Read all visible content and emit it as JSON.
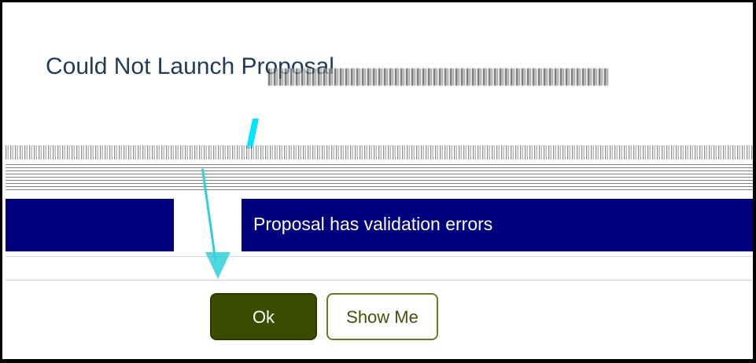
{
  "dialog": {
    "title": "Could Not Launch Proposal",
    "error_message": "Proposal has validation errors"
  },
  "buttons": {
    "ok_label": "Ok",
    "show_me_label": "Show Me"
  },
  "colors": {
    "banner_background": "#00007f",
    "ok_button_background": "#3b4b00",
    "show_me_border": "#6a7a24",
    "annotation_arrow": "#2fd0d8"
  }
}
